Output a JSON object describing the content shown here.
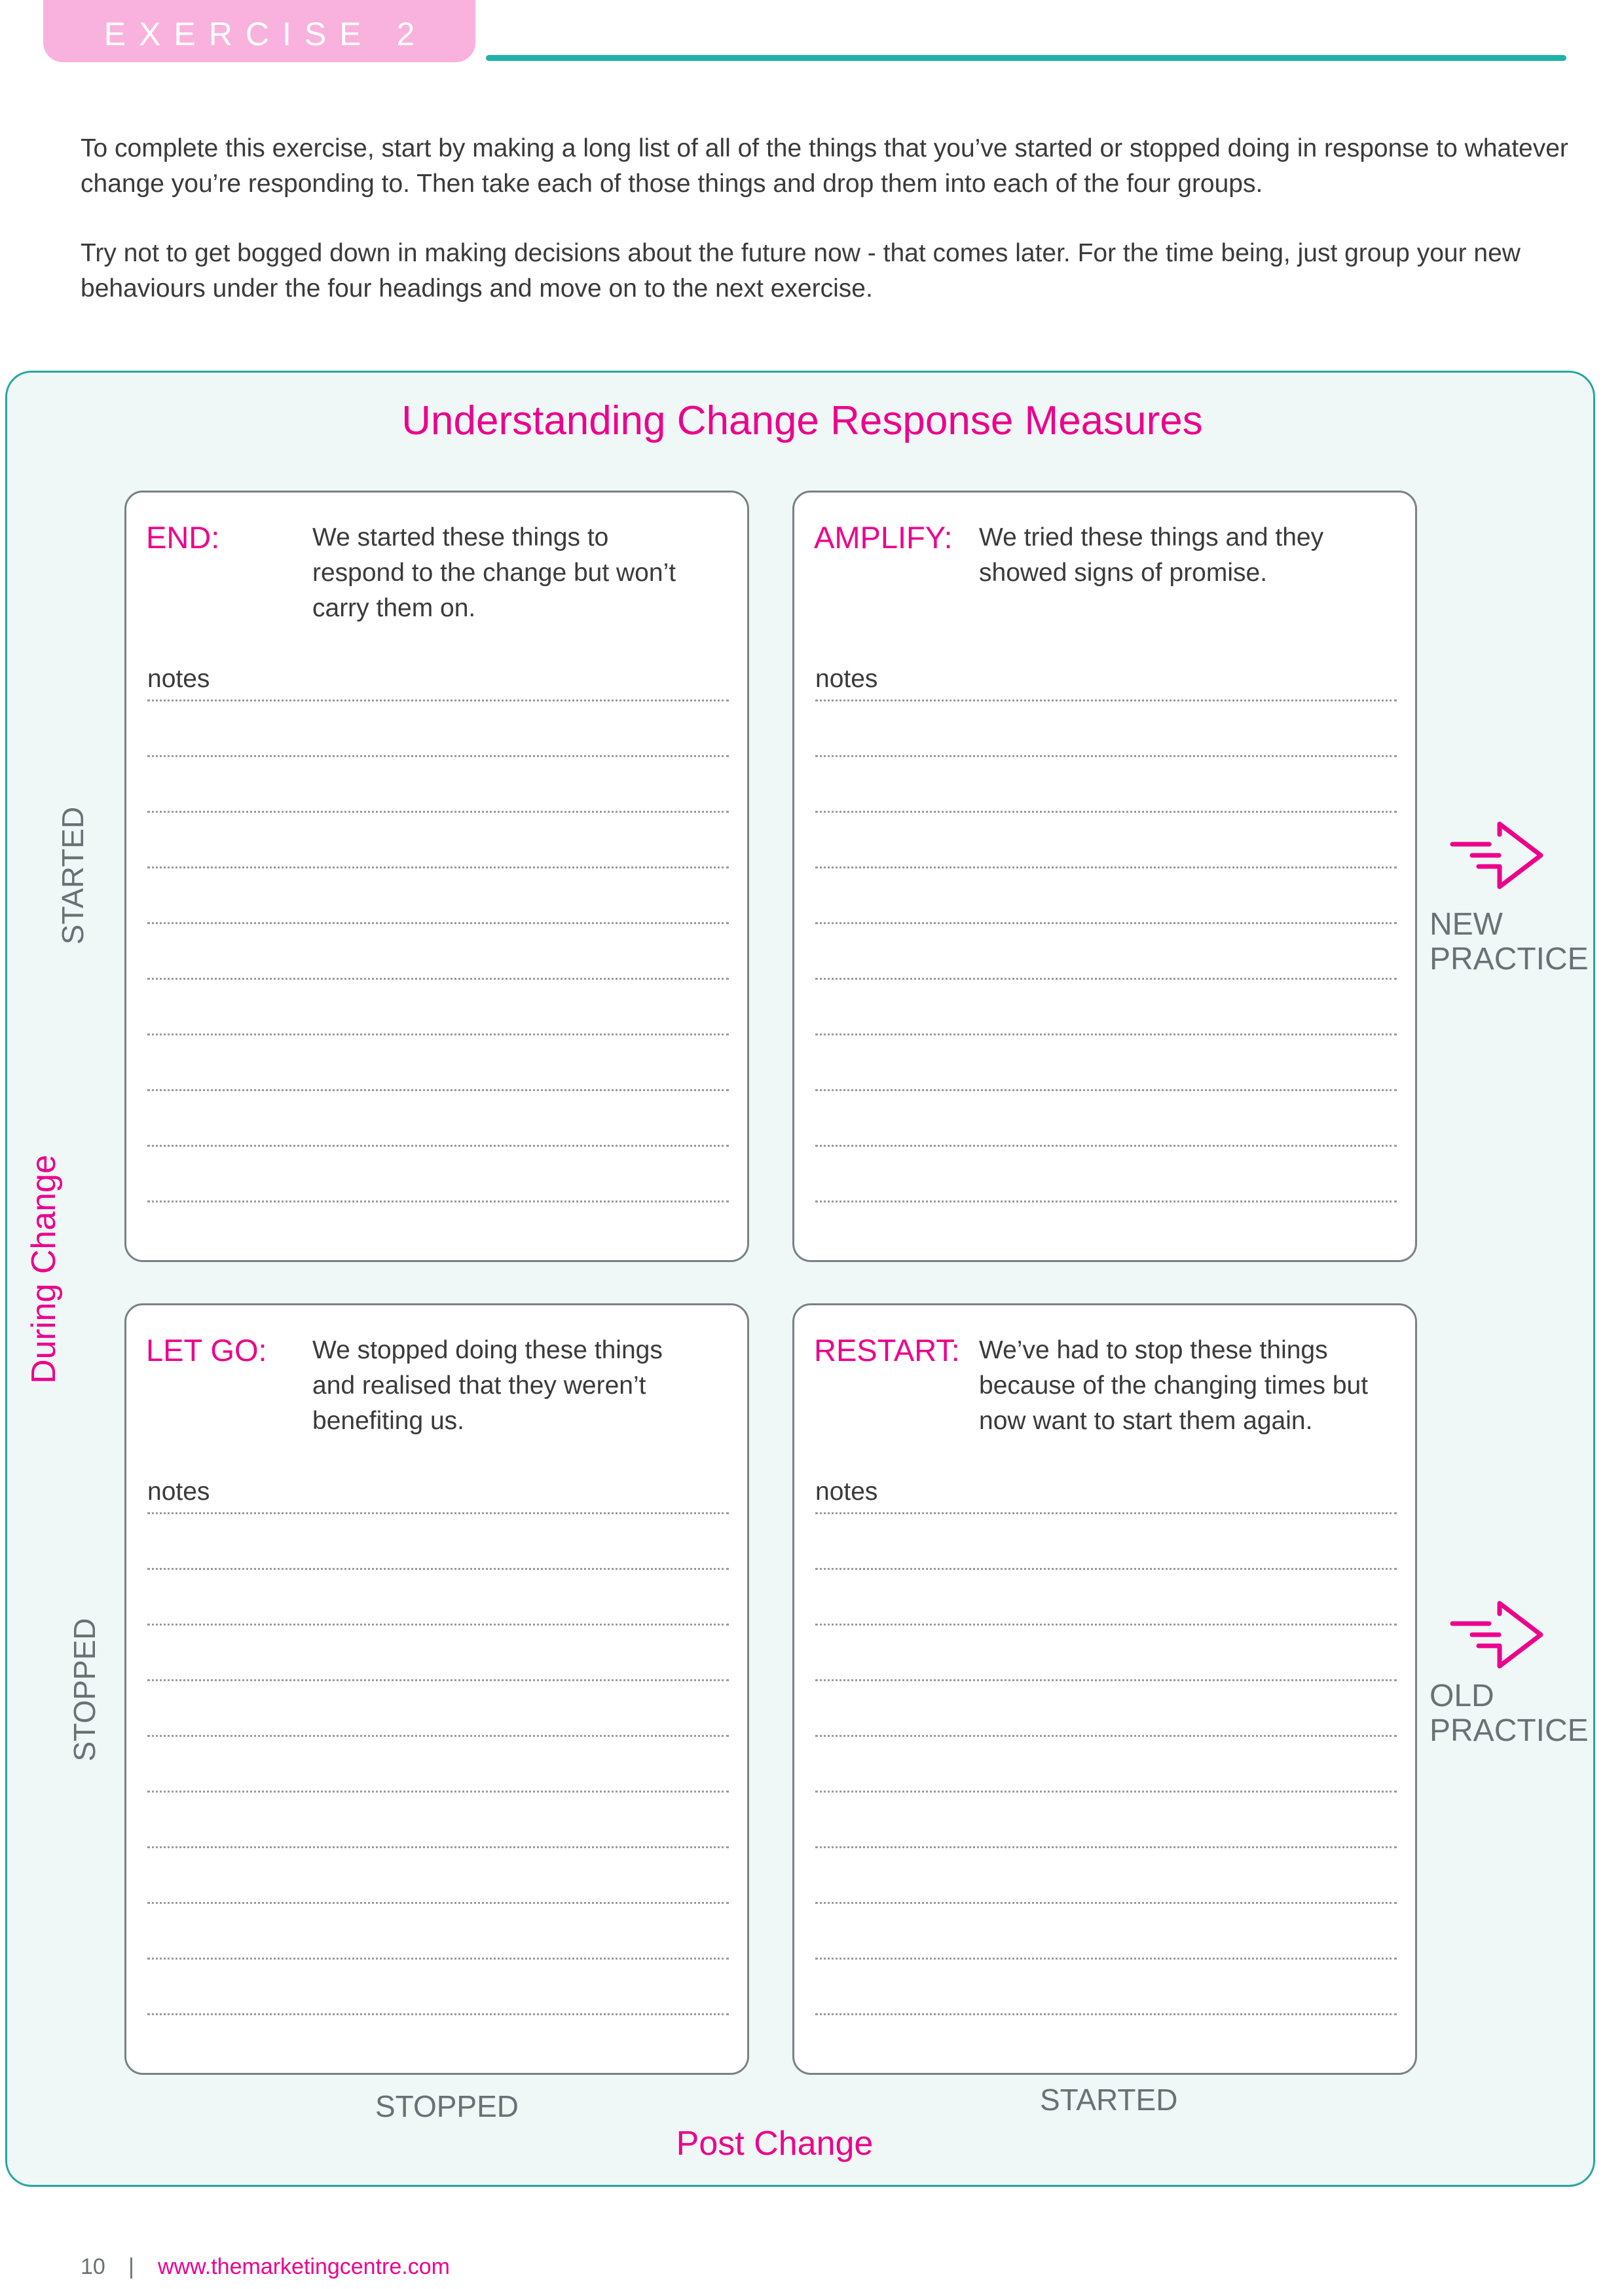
{
  "header": {
    "exercise_label": "EXERCISE 2"
  },
  "intro": {
    "paragraph_1": "To complete this exercise, start by making a long list of all of the things that you’ve started or stopped doing in response to whatever change you’re responding to. Then take each of those things and drop them into each of the four groups.",
    "paragraph_2": "Try not to get bogged down in making decisions about the future now - that comes later. For the time being, just group your new behaviours under the four headings and move on to the next exercise."
  },
  "matrix": {
    "title": "Understanding Change Response Measures",
    "y_axis_label": "During Change",
    "x_axis_label": "Post Change",
    "y_axis_ticks": {
      "top": "STARTED",
      "bottom": "STOPPED"
    },
    "x_axis_ticks": {
      "left": "STOPPED",
      "right": "STARTED"
    },
    "right_labels": [
      {
        "icon": "arrow-right-icon",
        "line1": "NEW",
        "line2": "PRACTICE"
      },
      {
        "icon": "arrow-right-icon",
        "line1": "OLD",
        "line2": "PRACTICE"
      }
    ],
    "quadrants": [
      {
        "key": "end",
        "label": "END:",
        "description": "We started these things to respond to the change but won’t carry them on.",
        "notes_label": "notes",
        "note_lines": 10
      },
      {
        "key": "amplify",
        "label": "AMPLIFY:",
        "description": "We tried these things and they showed signs of promise.",
        "notes_label": "notes",
        "note_lines": 10
      },
      {
        "key": "let-go",
        "label": "LET GO:",
        "description": "We stopped doing these things and realised that they weren’t benefiting us.",
        "notes_label": "notes",
        "note_lines": 10
      },
      {
        "key": "restart",
        "label": "RESTART:",
        "description": "We’ve had to stop these things because of the changing times but now want to start them again.",
        "notes_label": "notes",
        "note_lines": 10
      }
    ]
  },
  "footer": {
    "page_number": "10",
    "separator": "|",
    "url": "www.themarketingcentre.com"
  },
  "colors": {
    "accent_pink": "#ec008c",
    "pill_pink": "#f8b2dd",
    "teal": "#1fb2a9",
    "panel_bg": "#eff7f7",
    "label_gray": "#6b7075"
  }
}
